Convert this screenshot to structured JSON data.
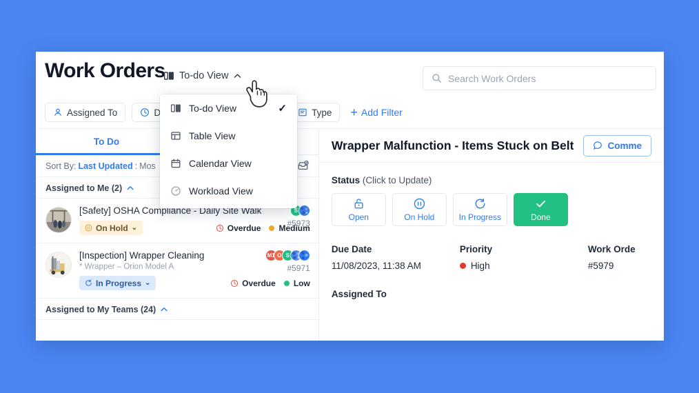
{
  "page": {
    "title": "Work Orders",
    "background_color": "#4a86f2",
    "accent_color": "#2f7bf0"
  },
  "header": {
    "view_switcher": {
      "label": "To-do View",
      "icon": "columns-icon",
      "chevron": "chevron-up-icon"
    },
    "search": {
      "placeholder": "Search Work Orders",
      "value": "",
      "icon": "search-icon"
    }
  },
  "filters": {
    "chips": [
      {
        "label": "Assigned To",
        "icon": "person-icon"
      },
      {
        "label": "Due Da",
        "icon": "clock-icon"
      },
      {
        "label": "Type",
        "icon": "type-icon"
      }
    ],
    "add_filter": {
      "label": "Add Filter",
      "plus": "+"
    }
  },
  "view_menu": {
    "items": [
      {
        "label": "To-do View",
        "icon": "columns-icon",
        "checked": true
      },
      {
        "label": "Table View",
        "icon": "table-icon",
        "checked": false
      },
      {
        "label": "Calendar View",
        "icon": "calendar-icon",
        "checked": false
      },
      {
        "label": "Workload View",
        "icon": "gauge-icon",
        "checked": false
      }
    ],
    "check_glyph": "✓"
  },
  "list_pane": {
    "tabs": [
      {
        "label": "To Do",
        "active": true
      },
      {
        "label": "",
        "active": false
      }
    ],
    "sort": {
      "prefix": "Sort By:",
      "field": "Last Updated",
      "separator": ":",
      "value": "Mos",
      "icon": "archive-inbox-icon"
    },
    "groups": [
      {
        "label": "Assigned to Me (2)",
        "chevron": "chevron-up-icon",
        "rows": [
          {
            "title": "[Safety] OSHA Compliance - Daily Site Walk",
            "subtitle": "",
            "status": {
              "label": "On Hold",
              "style": "onhold",
              "icon": "pause-icon",
              "caret": "⌄"
            },
            "overdue": {
              "label": "Overdue",
              "icon": "clock-icon",
              "color": "#e2574c"
            },
            "priority": {
              "label": "Medium",
              "color": "#f0a62a"
            },
            "id": "#5973",
            "avatars": [
              {
                "initials": "S",
                "color": "#22c183"
              },
              {
                "initials": "",
                "color": "#3f7fe0"
              }
            ]
          },
          {
            "title": "[Inspection] Wrapper Cleaning",
            "subtitle": "* Wrapper – Orion Model A",
            "status": {
              "label": "In Progress",
              "style": "inprog",
              "icon": "refresh-icon",
              "caret": "⌄"
            },
            "overdue": {
              "label": "Overdue",
              "icon": "clock-icon",
              "color": "#e2574c"
            },
            "priority": {
              "label": "Low",
              "color": "#22c183"
            },
            "id": "#5971",
            "avatars": [
              {
                "initials": "M1",
                "color": "#e2574c"
              },
              {
                "initials": "O",
                "color": "#ef6c4a"
              },
              {
                "initials": "S",
                "color": "#22c183"
              },
              {
                "initials": "",
                "color": "#3f7fe0"
              },
              {
                "initials": "",
                "color": "#2f7bf0"
              }
            ]
          }
        ]
      },
      {
        "label": "Assigned to My Teams (24)",
        "chevron": "chevron-up-icon",
        "rows": []
      }
    ]
  },
  "detail": {
    "title": "Wrapper Malfunction - Items Stuck on Belt",
    "comment_button": {
      "label": "Comme",
      "icon": "comment-icon"
    },
    "status_section": {
      "label": "Status",
      "hint": "(Click to Update)",
      "buttons": [
        {
          "label": "Open",
          "icon": "unlock-icon",
          "active": false
        },
        {
          "label": "On Hold",
          "icon": "pause-icon",
          "active": false
        },
        {
          "label": "In Progress",
          "icon": "refresh-icon",
          "active": false
        },
        {
          "label": "Done",
          "icon": "check-icon",
          "active": true
        }
      ]
    },
    "meta": {
      "due_date": {
        "label": "Due Date",
        "value": "11/08/2023, 11:38 AM"
      },
      "priority": {
        "label": "Priority",
        "value": "High",
        "color": "#e8382b"
      },
      "work_order": {
        "label": "Work Orde",
        "value": "#5979"
      }
    },
    "assigned_to_label": "Assigned To"
  }
}
